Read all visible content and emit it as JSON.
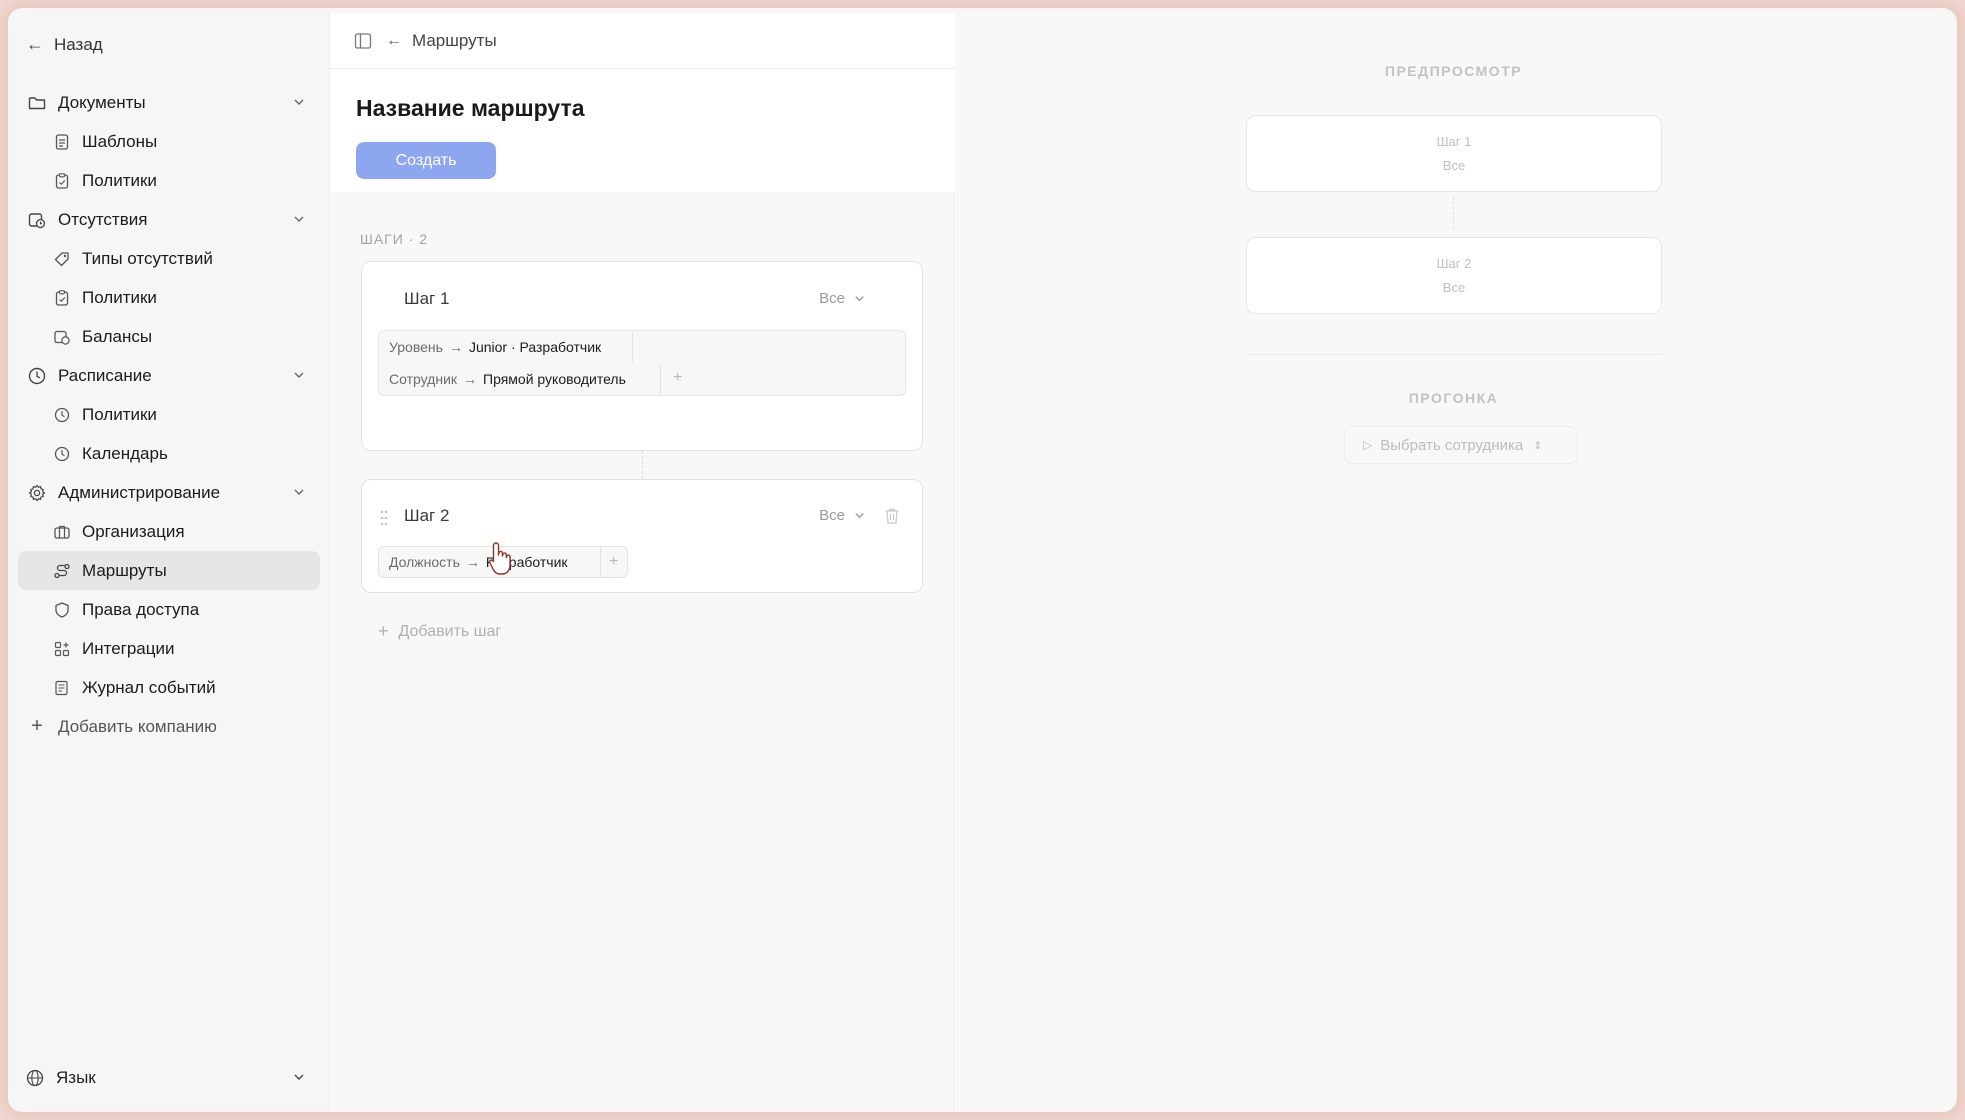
{
  "sidebar": {
    "back_label": "Назад",
    "groups": [
      {
        "label": "Документы",
        "icon": "folder-icon",
        "items": [
          {
            "label": "Шаблоны",
            "icon": "document-icon"
          },
          {
            "label": "Политики",
            "icon": "clipboard-icon"
          }
        ]
      },
      {
        "label": "Отсутствия",
        "icon": "calendar-clock-icon",
        "items": [
          {
            "label": "Типы отсутствий",
            "icon": "tag-icon"
          },
          {
            "label": "Политики",
            "icon": "clipboard-icon"
          },
          {
            "label": "Балансы",
            "icon": "calendar-clock-icon"
          }
        ]
      },
      {
        "label": "Расписание",
        "icon": "clock-icon",
        "items": [
          {
            "label": "Политики",
            "icon": "clock-icon"
          },
          {
            "label": "Календарь",
            "icon": "clock-icon"
          }
        ]
      },
      {
        "label": "Администрирование",
        "icon": "gear-icon",
        "items": [
          {
            "label": "Организация",
            "icon": "briefcase-icon"
          },
          {
            "label": "Маршруты",
            "icon": "route-icon",
            "active": true
          },
          {
            "label": "Права доступа",
            "icon": "shield-icon"
          },
          {
            "label": "Интеграции",
            "icon": "grid-plus-icon"
          },
          {
            "label": "Журнал событий",
            "icon": "log-icon"
          }
        ]
      }
    ],
    "add_company_label": "Добавить компанию",
    "language_label": "Язык"
  },
  "editor": {
    "breadcrumb": "Маршруты",
    "title": "Название маршрута",
    "create_label": "Создать",
    "steps_label": "ШАГИ · 2",
    "steps": [
      {
        "title": "Шаг 1",
        "approval": "Все",
        "conditions": [
          {
            "key": "Уровень",
            "arrow": "→",
            "value": "Junior · Разработчик"
          },
          {
            "key": "Сотрудник",
            "arrow": "→",
            "value": "Прямой руководитель"
          }
        ]
      },
      {
        "title": "Шаг 2",
        "approval": "Все",
        "conditions": [
          {
            "key": "Должность",
            "arrow": "→",
            "value": "Разработчик"
          }
        ]
      }
    ],
    "add_step_label": "Добавить шаг"
  },
  "preview": {
    "label": "ПРЕДПРОСМОТР",
    "steps": [
      {
        "title": "Шаг 1",
        "sub": "Все"
      },
      {
        "title": "Шаг 2",
        "sub": "Все"
      }
    ],
    "run_label": "ПРОГОНКА",
    "select_employee": "Выбрать сотрудника"
  }
}
